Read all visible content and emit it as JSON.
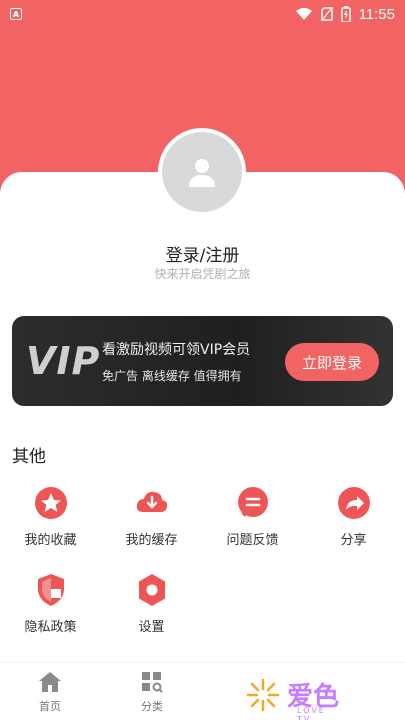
{
  "status_bar": {
    "time": "11:55"
  },
  "profile": {
    "title": "登录/注册",
    "subtitle": "快来开启凭剧之旅"
  },
  "vip": {
    "logo": "VIP",
    "line1": "看激励视频可领VIP会员",
    "line2": "免广告 离线缓存 值得拥有",
    "button": "立即登录"
  },
  "section": {
    "title": "其他"
  },
  "grid_items": [
    {
      "label": "我的收藏",
      "icon": "star-icon"
    },
    {
      "label": "我的缓存",
      "icon": "cloud-download-icon"
    },
    {
      "label": "问题反馈",
      "icon": "message-icon"
    },
    {
      "label": "分享",
      "icon": "share-icon"
    },
    {
      "label": "隐私政策",
      "icon": "shield-icon"
    },
    {
      "label": "设置",
      "icon": "settings-icon"
    }
  ],
  "tabbar": [
    {
      "label": "首页",
      "icon": "home-icon"
    },
    {
      "label": "分类",
      "icon": "category-icon"
    }
  ],
  "watermark": {
    "text": "爱色",
    "sub": "LOVE TV"
  },
  "colors": {
    "accent": "#f26363",
    "vip_bg": "#2d2d2d"
  }
}
